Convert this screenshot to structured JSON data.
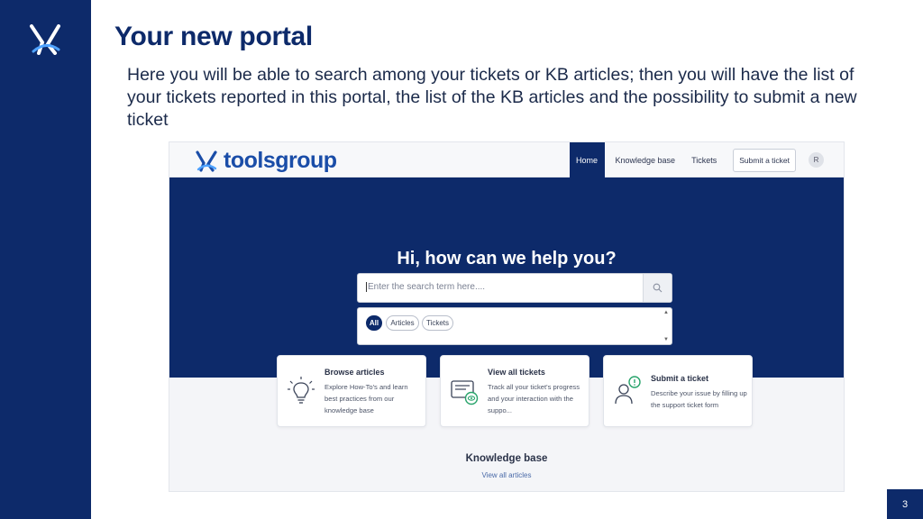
{
  "slide": {
    "title": "Your new portal",
    "body": "Here you will be able to search among your tickets or KB articles; then you will have the list of your tickets reported in this portal, the list of the KB articles and the possibility to submit a new ticket",
    "page_number": "3"
  },
  "portal": {
    "brand": "toolsgroup",
    "nav": {
      "home": "Home",
      "knowledge_base": "Knowledge base",
      "tickets": "Tickets",
      "submit": "Submit a ticket",
      "avatar": "R"
    },
    "hero_title": "Hi, how can we help you?",
    "search_placeholder": "Enter the search term here....",
    "filters": [
      "All",
      "Articles",
      "Tickets"
    ],
    "cards": [
      {
        "title": "Browse articles",
        "desc": "Explore How-To's and learn best practices from our knowledge base",
        "icon": "lightbulb-icon"
      },
      {
        "title": "View all tickets",
        "desc": "Track all your ticket's progress and your interaction with the suppo...",
        "icon": "ticket-view-icon"
      },
      {
        "title": "Submit a ticket",
        "desc": "Describe your issue by filling up the support ticket form",
        "icon": "user-alert-icon"
      }
    ],
    "kb_title": "Knowledge base",
    "kb_link": "View all articles"
  },
  "colors": {
    "navy": "#0d2a6a",
    "brand_blue": "#1a4da8",
    "accent_green": "#27a36a"
  }
}
